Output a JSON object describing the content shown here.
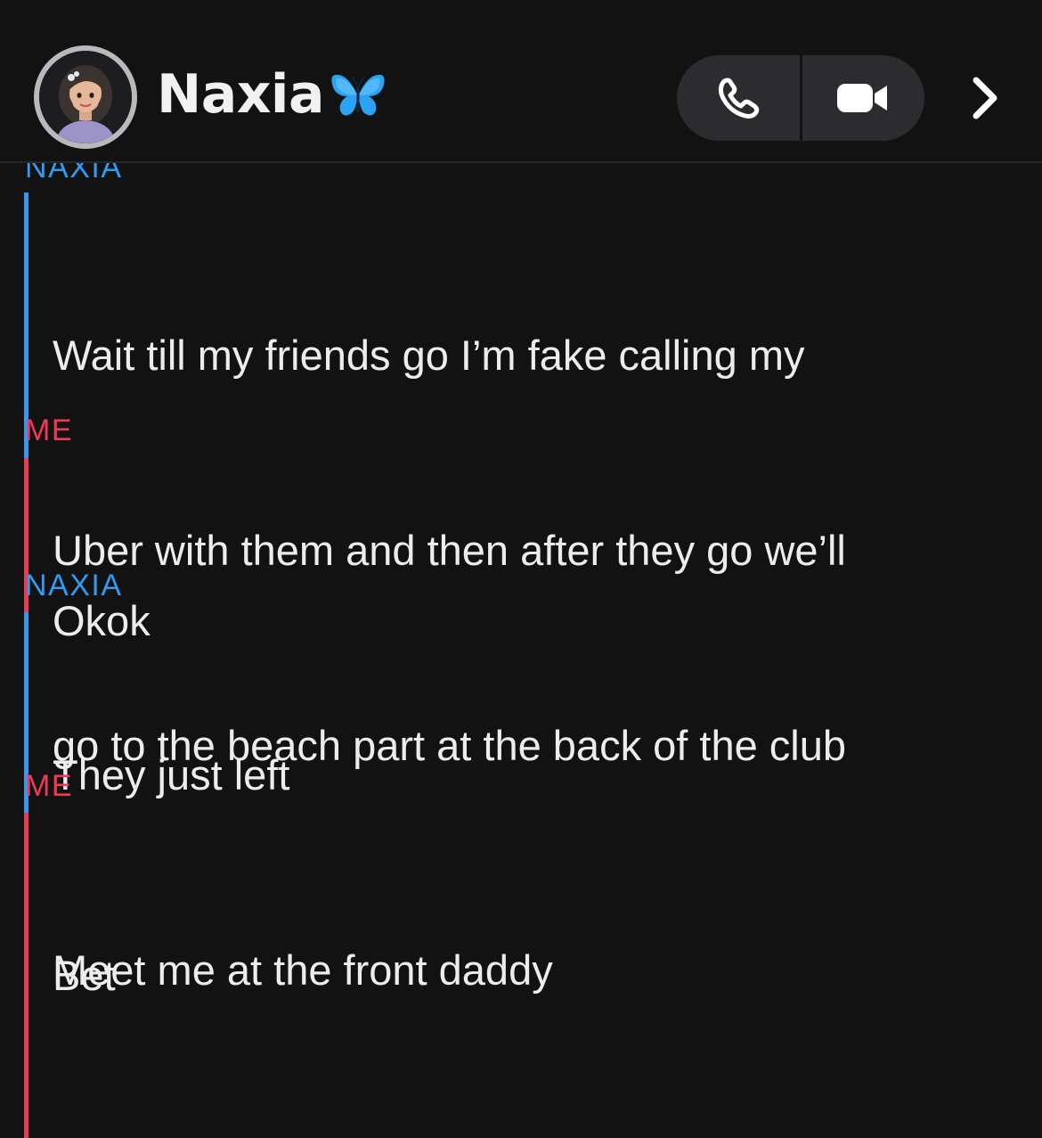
{
  "header": {
    "contact_name": "Naxia",
    "emoji_icon": "blue-butterfly-icon",
    "call_icon": "phone-icon",
    "video_icon": "video-camera-icon",
    "more_icon": "chevron-right-icon"
  },
  "colors": {
    "background": "#121213",
    "them_accent": "#2f9bf1",
    "me_accent": "#ee3a57",
    "button_bg": "#2c2c2e"
  },
  "messages": [
    {
      "sender": "NAXIA",
      "lines": [
        "Wait till my friends go I’m fake calling my",
        "Uber with them and then after they go we’ll",
        "go to the beach part at the back of the club"
      ]
    },
    {
      "sender": "ME",
      "lines": [
        "Okok"
      ]
    },
    {
      "sender": "NAXIA",
      "lines": [
        "They just left",
        "Meet me at the front daddy"
      ]
    },
    {
      "sender": "ME",
      "lines": [
        "Bet"
      ]
    }
  ]
}
